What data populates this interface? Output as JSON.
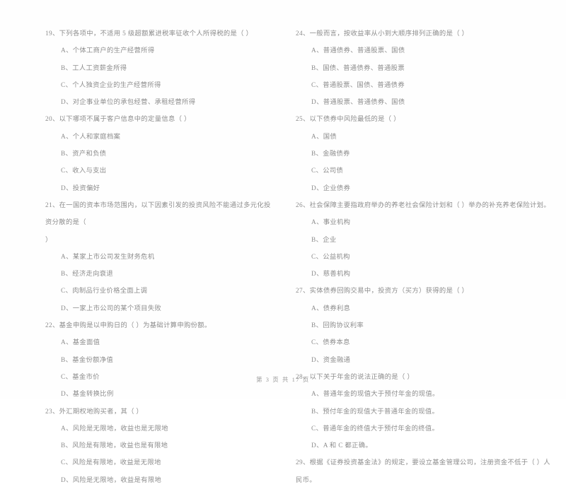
{
  "document": {
    "type": "scanned-exam-paper",
    "language": "zh-CN",
    "text_color": "#8d8d8d",
    "background_color": "#fefefe"
  },
  "footer": {
    "page_label": "第 3 页 共 17 页"
  },
  "columns": [
    {
      "side": "left",
      "questions": [
        {
          "number": "19",
          "stem": "19、下列各项中，不适用 5 级超额累进税率征收个人所得税的是（     ）",
          "options": [
            "A、个体工商户的生产经营所得",
            "B、工人工资薪金所得",
            "C、个人独资企业的生产经营所得",
            "D、对企事业单位的承包经营、承租经营所得"
          ]
        },
        {
          "number": "20",
          "stem": "20、以下哪项不属于客户信息中的定量信息（     ）",
          "options": [
            "A、个人和家庭档案",
            "B、资产和负债",
            "C、收入与支出",
            "D、投资偏好"
          ]
        },
        {
          "number": "21",
          "stem": "21、在一国的资本市场范围内，以下因素引发的投资风险不能通过多元化投资分散的是（",
          "stem_overflow": "）",
          "options": [
            "A、某家上市公司发生财务危机",
            "B、经济走向衰退",
            "C、肉制品行业价格全面上调",
            "D、一家上市公司的某个项目失败"
          ]
        },
        {
          "number": "22",
          "stem": "22、基金申购是以申购日的（     ）为基础计算申购份额。",
          "options": [
            "A、基金面值",
            "B、基金份额净值",
            "C、基金市价",
            "D、基金转换比例"
          ]
        },
        {
          "number": "23",
          "stem": "23、外汇期权地购买者，其（     ）",
          "options": [
            "A、风险是无限地，收益也是无限地",
            "B、风险是有限地，收益也是有限地",
            "C、风险是有限地，收益是无限地",
            "D、风险是无限地，收益是有限地"
          ]
        }
      ]
    },
    {
      "side": "right",
      "questions": [
        {
          "number": "24",
          "stem": "24、一般而言，按收益率从小到大顺序排列正确的是（     ）",
          "options": [
            "A、普通债券、普通股票、国债",
            "B、国债、普通债券、普通股票",
            "C、普通股票、国债、普通债券",
            "D、普通股票、普通债券、国债"
          ]
        },
        {
          "number": "25",
          "stem": "25、以下债券中风险最低的是（     ）",
          "options": [
            "A、国债",
            "B、金融债券",
            "C、公司债",
            "D、企业债券"
          ]
        },
        {
          "number": "26",
          "stem": "26、社会保障主要指政府举办的养老社会保险计划和（     ）举办的补充养老保险计划。",
          "options": [
            "A、事业机构",
            "B、企业",
            "C、公益机构",
            "D、慈善机构"
          ]
        },
        {
          "number": "27",
          "stem": "27、实体债券回购交易中，投资方（买方）获得的是（     ）",
          "options": [
            "A、债券利息",
            "B、回购协议利率",
            "C、债券本息",
            "D、资金融通"
          ]
        },
        {
          "number": "28",
          "stem": "28、以下关于年金的说法正确的是（     ）",
          "options": [
            "A、普通年金的现值大于预付年金的现值。",
            "B、预付年金的现值大于普通年金的现值。",
            "C、普通年金的终值大于预付年金的终值。",
            "D、A 和 C 都正确。"
          ]
        },
        {
          "number": "29",
          "stem": "29、根据《证券投资基金法》的规定，要设立基金管理公司，注册资金不低于（     ）人民币。",
          "options": []
        }
      ]
    }
  ]
}
